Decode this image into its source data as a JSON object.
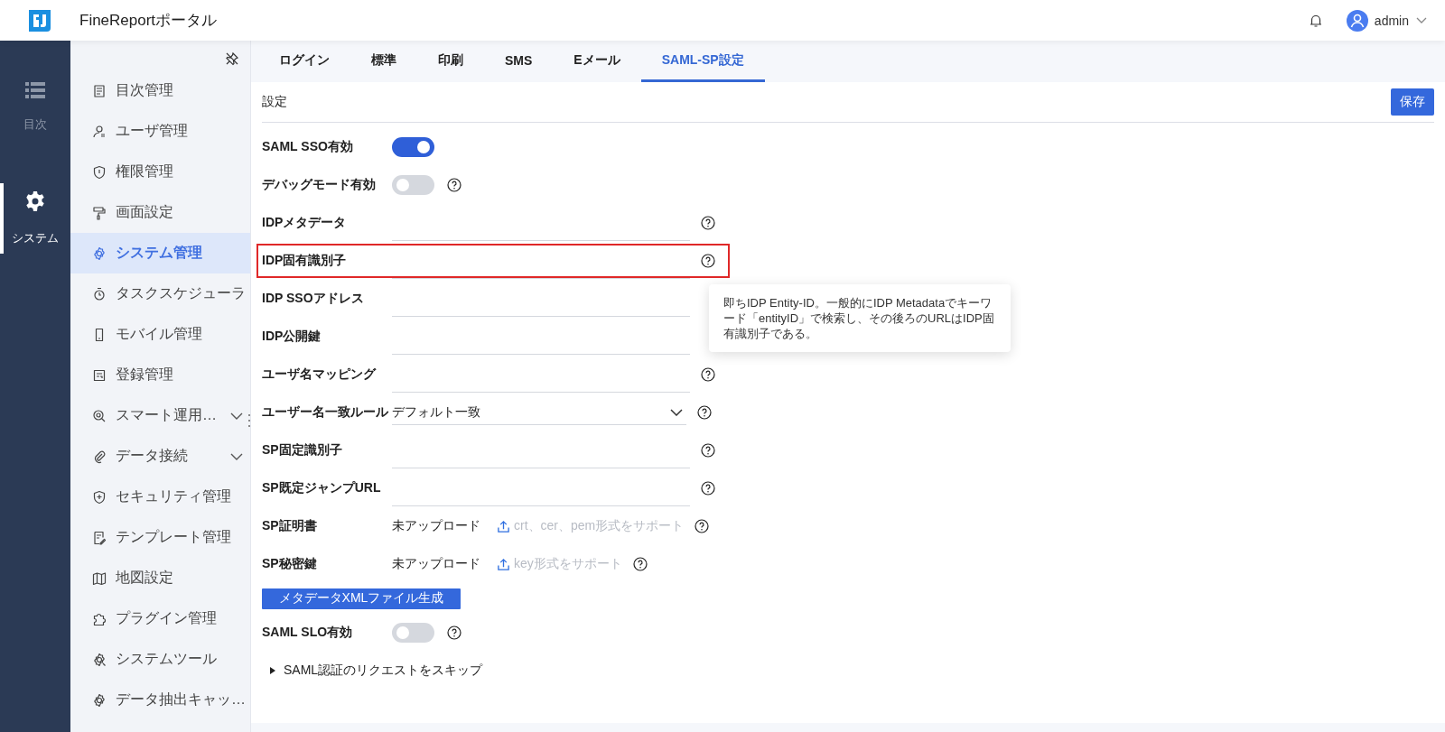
{
  "header": {
    "title": "FineReportポータル",
    "user": "admin"
  },
  "rail": [
    {
      "label": "目次",
      "selected": false
    },
    {
      "label": "システム",
      "selected": true
    }
  ],
  "sidebar": {
    "items": [
      {
        "label": "目次管理",
        "selected": false,
        "expandable": false
      },
      {
        "label": "ユーザ管理",
        "selected": false,
        "expandable": false
      },
      {
        "label": "権限管理",
        "selected": false,
        "expandable": false
      },
      {
        "label": "画面設定",
        "selected": false,
        "expandable": false
      },
      {
        "label": "システム管理",
        "selected": true,
        "expandable": false
      },
      {
        "label": "タスクスケジューラ",
        "selected": false,
        "expandable": false
      },
      {
        "label": "モバイル管理",
        "selected": false,
        "expandable": false
      },
      {
        "label": "登録管理",
        "selected": false,
        "expandable": false
      },
      {
        "label": "スマート運用…",
        "selected": false,
        "expandable": true
      },
      {
        "label": "データ接続",
        "selected": false,
        "expandable": true
      },
      {
        "label": "セキュリティ管理",
        "selected": false,
        "expandable": false
      },
      {
        "label": "テンプレート管理",
        "selected": false,
        "expandable": false
      },
      {
        "label": "地図設定",
        "selected": false,
        "expandable": false
      },
      {
        "label": "プラグイン管理",
        "selected": false,
        "expandable": false
      },
      {
        "label": "システムツール",
        "selected": false,
        "expandable": false
      },
      {
        "label": "データ抽出キャッ…",
        "selected": false,
        "expandable": false
      }
    ]
  },
  "tabs": [
    {
      "label": "ログイン",
      "selected": false
    },
    {
      "label": "標準",
      "selected": false
    },
    {
      "label": "印刷",
      "selected": false
    },
    {
      "label": "SMS",
      "selected": false
    },
    {
      "label": "Eメール",
      "selected": false
    },
    {
      "label": "SAML-SP設定",
      "selected": true
    }
  ],
  "section": {
    "title": "設定",
    "save_button": "保存"
  },
  "rows": [
    {
      "kind": "toggle",
      "label": "SAML SSO有効",
      "on": true,
      "help": false
    },
    {
      "kind": "toggle",
      "label": "デバッグモード有効",
      "on": false,
      "help": true
    },
    {
      "kind": "input",
      "label": "IDPメタデータ",
      "help": true,
      "highlighted": false
    },
    {
      "kind": "input",
      "label": "IDP固有識別子",
      "help": true,
      "highlighted": true
    },
    {
      "kind": "input",
      "label": "IDP SSOアドレス",
      "help": false,
      "highlighted": false
    },
    {
      "kind": "input",
      "label": "IDP公開鍵",
      "help": false,
      "highlighted": false
    },
    {
      "kind": "input",
      "label": "ユーザ名マッピング",
      "help": true,
      "highlighted": false
    },
    {
      "kind": "select",
      "label": "ユーザー名一致ルール",
      "value": "デフォルト一致",
      "help": true
    },
    {
      "kind": "input",
      "label": "SP固定識別子",
      "help": true,
      "highlighted": false
    },
    {
      "kind": "input",
      "label": "SP既定ジャンプURL",
      "help": true,
      "highlighted": false
    },
    {
      "kind": "upload",
      "label": "SP証明書",
      "status": "未アップロード",
      "hint": "crt、cer、pem形式をサポート",
      "help": true
    },
    {
      "kind": "upload",
      "label": "SP秘密鍵",
      "status": "未アップロード",
      "hint": "key形式をサポート",
      "help": true
    },
    {
      "kind": "button",
      "label": "メタデータXMLファイル生成"
    },
    {
      "kind": "toggle",
      "label": "SAML SLO有効",
      "on": false,
      "help": true
    },
    {
      "kind": "collapse",
      "label": "SAML認証のリクエストをスキップ",
      "expanded": false
    }
  ],
  "tooltip": {
    "text": "即ちIDP Entity-ID。一般的にIDP Metadataでキーワード「entityID」で検索し、その後ろのURLはIDP固有識別子である。"
  }
}
